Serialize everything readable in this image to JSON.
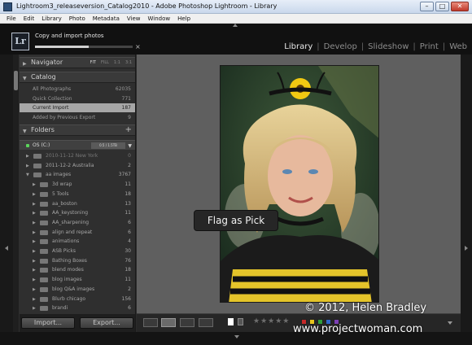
{
  "window": {
    "title": "Lightroom3_releaseversion_Catalog2010 - Adobe Photoshop Lightroom - Library",
    "controls": {
      "minimize": "–",
      "maximize": "□",
      "close": "✕"
    }
  },
  "menubar": [
    "File",
    "Edit",
    "Library",
    "Photo",
    "Metadata",
    "View",
    "Window",
    "Help"
  ],
  "identity": {
    "logo": "Lr",
    "status_text": "Copy and import photos",
    "progress": 0.55,
    "cancel": "×"
  },
  "modules": [
    "Library",
    "Develop",
    "Slideshow",
    "Print",
    "Web"
  ],
  "active_module": "Library",
  "navigator": {
    "label": "Navigator",
    "options": [
      "FIT",
      "FILL",
      "1:1",
      "3:1"
    ],
    "selected": "FIT"
  },
  "catalog": {
    "label": "Catalog",
    "items": [
      {
        "name": "All Photographs",
        "count": "62035"
      },
      {
        "name": "Quick Collection",
        "count": "771"
      },
      {
        "name": "Current Import",
        "count": "187"
      },
      {
        "name": "Added by Previous Export",
        "count": "9"
      }
    ],
    "selected": "Current Import"
  },
  "folders": {
    "label": "Folders",
    "add": "+",
    "volume": {
      "name": "OS (C:)",
      "capacity": "0.5 / 1.5TB"
    },
    "items": [
      {
        "name": "2010-11-12 New York",
        "count": "0",
        "level": 0,
        "expanded": false
      },
      {
        "name": "2011-12-2 Australia",
        "count": "2",
        "level": 0,
        "expanded": false
      },
      {
        "name": "aa images",
        "count": "3767",
        "level": 0,
        "expanded": true
      },
      {
        "name": "3d wrap",
        "count": "11",
        "level": 1,
        "expanded": false
      },
      {
        "name": "5 Tools",
        "count": "18",
        "level": 1,
        "expanded": false
      },
      {
        "name": "aa_boston",
        "count": "13",
        "level": 1,
        "expanded": false
      },
      {
        "name": "AA_keystoning",
        "count": "11",
        "level": 1,
        "expanded": false
      },
      {
        "name": "AA_sharpening",
        "count": "6",
        "level": 1,
        "expanded": false
      },
      {
        "name": "align and repeat",
        "count": "6",
        "level": 1,
        "expanded": false
      },
      {
        "name": "animations",
        "count": "4",
        "level": 1,
        "expanded": false
      },
      {
        "name": "ASB Picks",
        "count": "30",
        "level": 1,
        "expanded": false
      },
      {
        "name": "Bathing Boxes",
        "count": "76",
        "level": 1,
        "expanded": false
      },
      {
        "name": "blend modes",
        "count": "18",
        "level": 1,
        "expanded": false
      },
      {
        "name": "blog images",
        "count": "11",
        "level": 1,
        "expanded": false
      },
      {
        "name": "blog Q&A images",
        "count": "2",
        "level": 1,
        "expanded": false
      },
      {
        "name": "Blurb chicago",
        "count": "156",
        "level": 1,
        "expanded": false
      },
      {
        "name": "brandi",
        "count": "6",
        "level": 1,
        "expanded": false
      }
    ]
  },
  "buttons": {
    "import": "Import...",
    "export": "Export..."
  },
  "tooltip": "Flag as Pick",
  "toolbar": {
    "stars": "★★★★★",
    "label_colors": [
      "#c62828",
      "#e6c41c",
      "#2e9e3a",
      "#2f66c8",
      "#7b3fb5"
    ]
  },
  "watermark": {
    "line1": "© 2012, Helen Bradley",
    "line2": "www.projectwoman.com"
  }
}
